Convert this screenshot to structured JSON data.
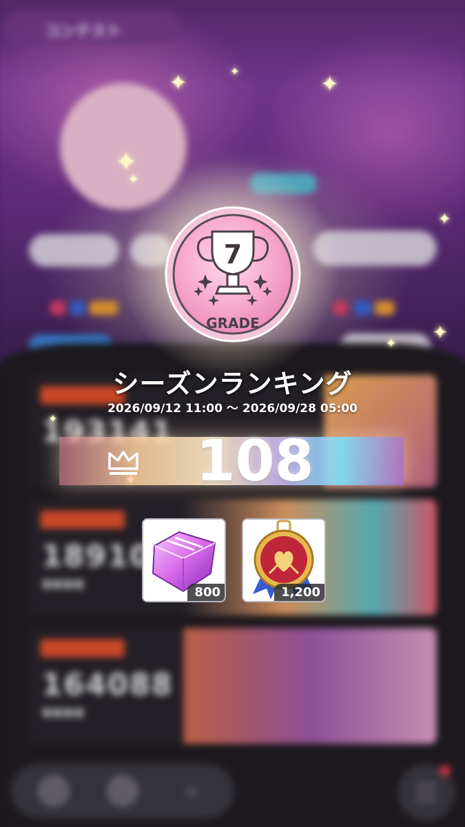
{
  "background": {
    "header_title": "コンテスト",
    "card_scores": [
      "193141",
      "189100",
      "164088"
    ]
  },
  "badge": {
    "grade_number": "7",
    "grade_label": "GRADE"
  },
  "season": {
    "title": "シーズンランキング",
    "period": "2026/09/12 11:00 〜 2026/09/28 05:00"
  },
  "rank": {
    "value": "108"
  },
  "rewards": [
    {
      "icon": "gem-icon",
      "quantity": "800"
    },
    {
      "icon": "medal-icon",
      "quantity": "1,200"
    }
  ],
  "colors": {
    "badge_pink": "#f4a6c8",
    "tag_orange": "#e2502a",
    "menu_notice": "#e23a4a"
  }
}
